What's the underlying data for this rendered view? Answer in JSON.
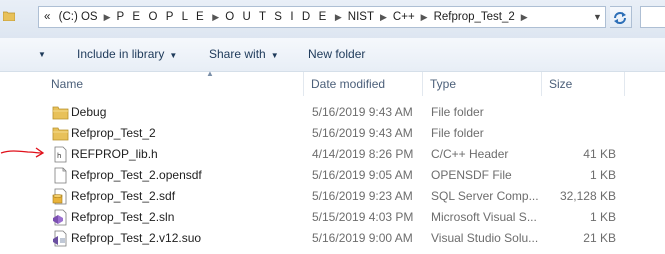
{
  "address": {
    "crumbs": [
      "«",
      "(C:) OS",
      "P E O P L E",
      "O U T S I D E",
      "NIST",
      "C++",
      "Refprop_Test_2"
    ],
    "dropdown_icon": "chevron-down-icon",
    "refresh_icon": "refresh-icon"
  },
  "toolbar": {
    "include_label": "Include in library",
    "share_label": "Share with",
    "newfolder_label": "New folder"
  },
  "columns": {
    "name": "Name",
    "date": "Date modified",
    "type": "Type",
    "size": "Size"
  },
  "files": [
    {
      "name": "Debug",
      "date": "5/16/2019 9:43 AM",
      "type": "File folder",
      "size": "",
      "icon": "folder-icon"
    },
    {
      "name": "Refprop_Test_2",
      "date": "5/16/2019 9:43 AM",
      "type": "File folder",
      "size": "",
      "icon": "folder-icon"
    },
    {
      "name": "REFPROP_lib.h",
      "date": "4/14/2019 8:26 PM",
      "type": "C/C++ Header",
      "size": "41 KB",
      "icon": "header-file-icon"
    },
    {
      "name": "Refprop_Test_2.opensdf",
      "date": "5/16/2019 9:05 AM",
      "type": "OPENSDF File",
      "size": "1 KB",
      "icon": "file-icon"
    },
    {
      "name": "Refprop_Test_2.sdf",
      "date": "5/16/2019 9:23 AM",
      "type": "SQL Server Comp...",
      "size": "32,128 KB",
      "icon": "sql-file-icon"
    },
    {
      "name": "Refprop_Test_2.sln",
      "date": "5/15/2019 4:03 PM",
      "type": "Microsoft Visual S...",
      "size": "1 KB",
      "icon": "solution-file-icon"
    },
    {
      "name": "Refprop_Test_2.v12.suo",
      "date": "5/16/2019 9:00 AM",
      "type": "Visual Studio Solu...",
      "size": "21 KB",
      "icon": "suo-file-icon"
    }
  ],
  "colors": {
    "toolbar_text": "#1e3a5a",
    "header_text": "#4c607a",
    "annotation": "#e0101a",
    "folder": "#e8c15a"
  }
}
